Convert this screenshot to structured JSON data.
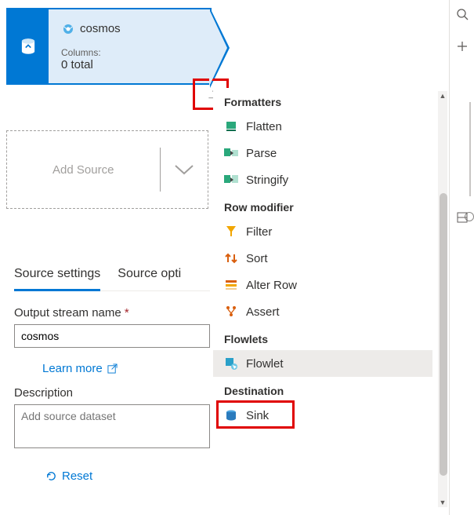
{
  "node": {
    "title": "cosmos",
    "columns_label": "Columns:",
    "columns_count": "0 total"
  },
  "add_source": {
    "label": "Add Source"
  },
  "tabs": {
    "settings": "Source settings",
    "options": "Source opti"
  },
  "form": {
    "output_stream_label": "Output stream name",
    "output_stream_value": "cosmos",
    "learn_more": "Learn more",
    "description_label": "Description",
    "description_placeholder": "Add source dataset",
    "reset": "Reset"
  },
  "menu": {
    "section_formatters": "Formatters",
    "flatten": "Flatten",
    "parse": "Parse",
    "stringify": "Stringify",
    "section_row_modifier": "Row modifier",
    "filter": "Filter",
    "sort": "Sort",
    "alter_row": "Alter Row",
    "assert": "Assert",
    "section_flowlets": "Flowlets",
    "flowlet": "Flowlet",
    "section_destination": "Destination",
    "sink": "Sink"
  },
  "colors": {
    "primary": "#0078d4",
    "highlight": "#e00000"
  }
}
